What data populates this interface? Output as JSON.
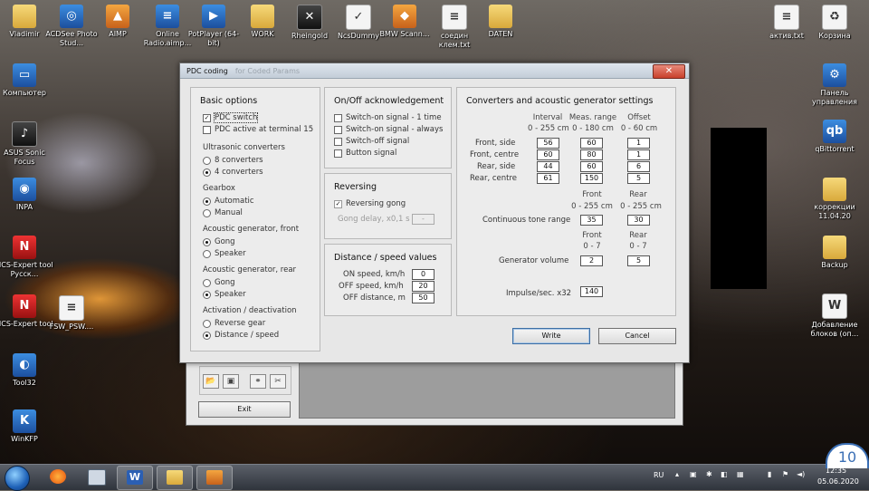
{
  "desktop": {
    "left_icons": [
      {
        "label": "Vladimir",
        "glyph": "",
        "style": "folder"
      },
      {
        "label": "Компьютер",
        "glyph": "▭",
        "style": "app-blue"
      },
      {
        "label": "ASUS Sonic Focus",
        "glyph": "♪",
        "style": "app-dark"
      },
      {
        "label": "INPA",
        "glyph": "◉",
        "style": "app-blue"
      },
      {
        "label": "NCS-Expert tool Русск...",
        "glyph": "N",
        "style": "app-red"
      },
      {
        "label": "NCS-Expert tool",
        "glyph": "N",
        "style": "app-red"
      },
      {
        "label": "Tool32",
        "glyph": "◐",
        "style": "app-blue"
      },
      {
        "label": "WinKFP",
        "glyph": "K",
        "style": "app-blue"
      }
    ],
    "top_icons": [
      {
        "label": "ACDSee Photo Stud...",
        "glyph": "◎",
        "style": "app-blue"
      },
      {
        "label": "AIMP",
        "glyph": "▲",
        "style": "app-orange"
      },
      {
        "label": "Online Radio.aimp...",
        "glyph": "≡",
        "style": "app-blue"
      },
      {
        "label": "PotPlayer (64-bit)",
        "glyph": "▶",
        "style": "app-blue"
      },
      {
        "label": "WORK",
        "glyph": "",
        "style": "folder"
      },
      {
        "label": "Rheingold",
        "glyph": "✕",
        "style": "app-dark"
      },
      {
        "label": "NcsDummy",
        "glyph": "✓",
        "style": "app-white"
      },
      {
        "label": "BMW Scann...",
        "glyph": "◆",
        "style": "app-orange"
      },
      {
        "label": "соедин клем.txt",
        "glyph": "≡",
        "style": "app-white"
      },
      {
        "label": "DATEN",
        "glyph": "",
        "style": "folder"
      }
    ],
    "fsw_icon": {
      "label": "FSW_PSW....",
      "glyph": "≡",
      "style": "app-white"
    },
    "right_icons": [
      {
        "label": "актив.txt",
        "glyph": "≡",
        "style": "app-white"
      },
      {
        "label": "Корзина",
        "glyph": "♻",
        "style": "app-white"
      },
      {
        "label": "Панель управления",
        "glyph": "⚙",
        "style": "app-blue"
      },
      {
        "label": "qBittorrent",
        "glyph": "qb",
        "style": "app-blue"
      },
      {
        "label": "коррекции 11.04.20",
        "glyph": "",
        "style": "folder"
      },
      {
        "label": "Backup",
        "glyph": "",
        "style": "folder"
      },
      {
        "label": "Добавление блоков (оп...",
        "glyph": "W",
        "style": "app-white"
      }
    ]
  },
  "window": {
    "title": "PDC coding",
    "title_extra": "for Coded Params",
    "close_label": "✕",
    "basic": {
      "title": "Basic options",
      "pdc_switch": {
        "label": "PDC switch",
        "checked": true
      },
      "pdc_terminal": {
        "label": "PDC active at terminal 15",
        "checked": false
      },
      "ultrasonic_label": "Ultrasonic converters",
      "ultrasonic_8": "8 converters",
      "ultrasonic_4": "4 converters",
      "gearbox_label": "Gearbox",
      "gearbox_auto": "Automatic",
      "gearbox_manual": "Manual",
      "ag_front_label": "Acoustic generator, front",
      "ag_front_gong": "Gong",
      "ag_front_speaker": "Speaker",
      "ag_rear_label": "Acoustic generator, rear",
      "ag_rear_gong": "Gong",
      "ag_rear_speaker": "Speaker",
      "activation_label": "Activation / deactivation",
      "activation_reverse": "Reverse gear",
      "activation_distance": "Distance / speed"
    },
    "onoff": {
      "title": "On/Off acknowledgement",
      "items": [
        "Switch-on signal - 1 time",
        "Switch-on signal - always",
        "Switch-off signal",
        "Button signal"
      ]
    },
    "reversing": {
      "title": "Reversing",
      "gong_label": "Reversing gong",
      "delay_label": "Gong delay, x0,1 s",
      "delay_value": "-"
    },
    "distance": {
      "title": "Distance / speed values",
      "rows": [
        {
          "label": "ON speed, km/h",
          "value": "0"
        },
        {
          "label": "OFF speed, km/h",
          "value": "20"
        },
        {
          "label": "OFF distance, m",
          "value": "50"
        }
      ]
    },
    "converters": {
      "title": "Converters and acoustic generator settings",
      "col_interval": "Interval",
      "col_interval_range": "0 - 255 cm",
      "col_meas": "Meas. range",
      "col_meas_range": "0 - 180 cm",
      "col_offset": "Offset",
      "col_offset_range": "0 - 60 cm",
      "rows": [
        {
          "label": "Front, side",
          "interval": "56",
          "meas": "60",
          "offset": "1"
        },
        {
          "label": "Front, centre",
          "interval": "60",
          "meas": "80",
          "offset": "1"
        },
        {
          "label": "Rear, side",
          "interval": "44",
          "meas": "60",
          "offset": "6"
        },
        {
          "label": "Rear, centre",
          "interval": "61",
          "meas": "150",
          "offset": "5"
        }
      ],
      "front_label": "Front",
      "rear_label": "Rear",
      "tone_range_front": "0 - 255 cm",
      "tone_range_rear": "0 - 255 cm",
      "tone_label": "Continuous tone range",
      "tone_front": "35",
      "tone_rear": "30",
      "front_label2": "Front",
      "rear_label2": "Rear",
      "vol_range_front": "0 - 7",
      "vol_range_rear": "0 - 7",
      "volume_label": "Generator volume",
      "volume_front": "2",
      "volume_rear": "5",
      "impulse_label": "Impulse/sec. x32",
      "impulse_value": "140"
    },
    "write_label": "Write",
    "cancel_label": "Cancel",
    "exit_label": "Exit"
  },
  "taskbar": {
    "lang": "RU",
    "time": "12:35",
    "date": "05.06.2020"
  }
}
